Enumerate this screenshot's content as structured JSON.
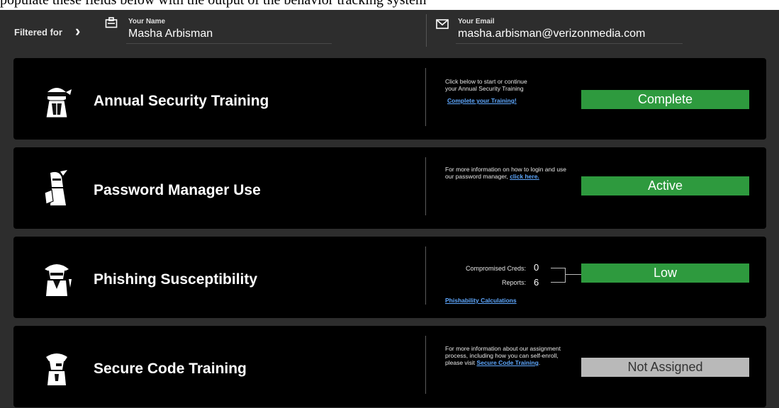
{
  "top_cut_text": "populate these fields below with the output of the behavior tracking system",
  "filter_bar": {
    "filtered_label": "Filtered for",
    "name_label": "Your Name",
    "name_value": "Masha Arbisman",
    "email_label": "Your Email",
    "email_value": "masha.arbisman@verizonmedia.com"
  },
  "cards": [
    {
      "title": "Annual Security Training",
      "description": "Click below to start or continue your Annual Security Training",
      "link": "Complete your Training!",
      "status": "Complete",
      "status_color": "#2e9a3e"
    },
    {
      "title": "Password Manager Use",
      "description": "For more information on how to login and use our password manager,",
      "link": "click here.",
      "status": "Active",
      "status_color": "#2e9a3e"
    },
    {
      "title": "Phishing Susceptibility",
      "metrics": [
        {
          "label": "Compromised Creds:",
          "value": "0"
        },
        {
          "label": "Reports:",
          "value": "6"
        }
      ],
      "link": "Phishability Calculations",
      "status": "Low",
      "status_color": "#2e9a3e"
    },
    {
      "title": "Secure Code Training",
      "description": "For more information about our assignment process, including how you can self-enroll, please visit",
      "link": "Secure Code Training",
      "link_suffix": ".",
      "status": "Not Assigned",
      "status_color": "#b9b9b9"
    }
  ]
}
